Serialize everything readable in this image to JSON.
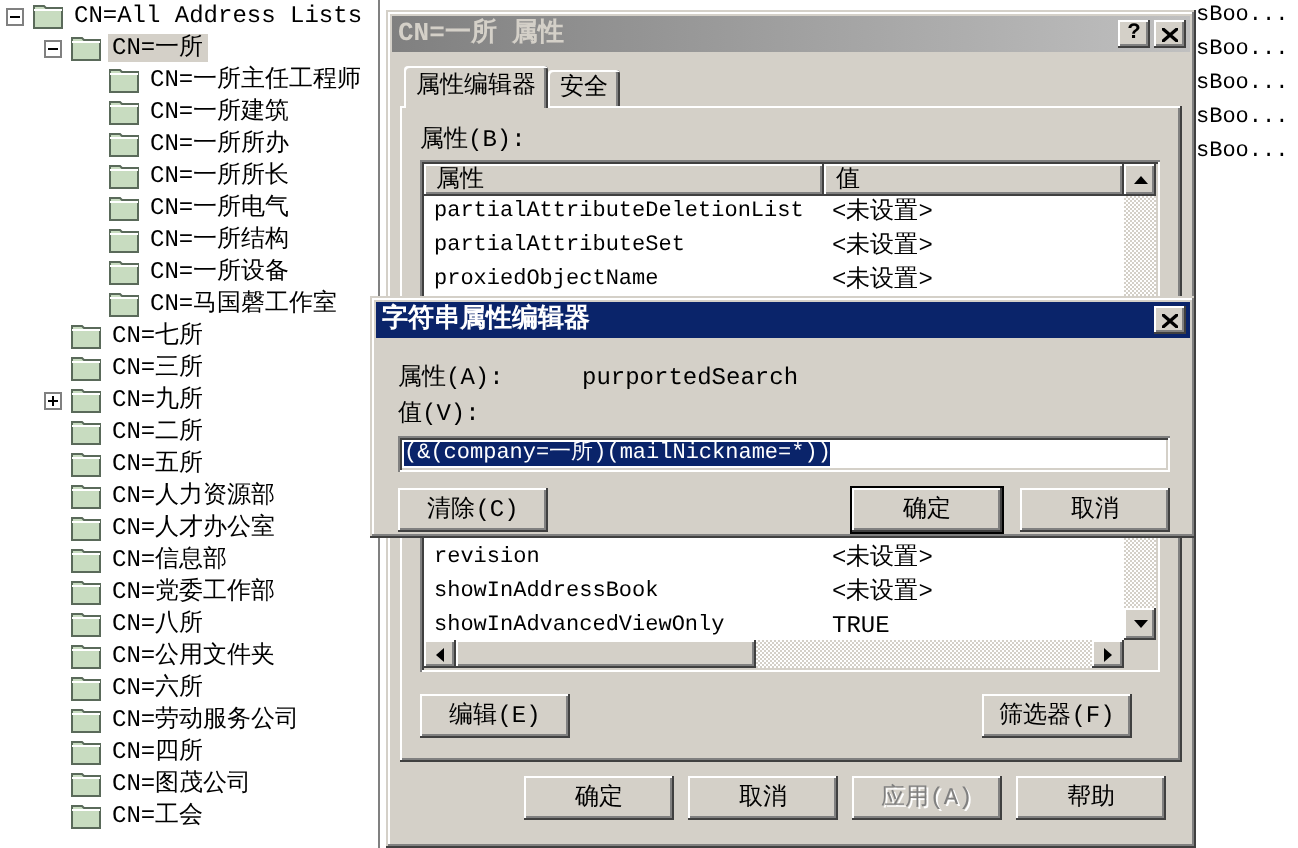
{
  "tree": [
    {
      "label": "CN=All Address Lists",
      "expanded": true,
      "selected": false,
      "children": [
        {
          "label": "CN=一所",
          "expanded": true,
          "selected": true,
          "children": [
            {
              "label": "CN=一所主任工程师",
              "selected": false
            },
            {
              "label": "CN=一所建筑",
              "selected": false
            },
            {
              "label": "CN=一所所办",
              "selected": false
            },
            {
              "label": "CN=一所所长",
              "selected": false
            },
            {
              "label": "CN=一所电气",
              "selected": false
            },
            {
              "label": "CN=一所结构",
              "selected": false
            },
            {
              "label": "CN=一所设备",
              "selected": false
            },
            {
              "label": "CN=马国磬工作室",
              "selected": false
            }
          ]
        },
        {
          "label": "CN=七所",
          "selected": false
        },
        {
          "label": "CN=三所",
          "selected": false
        },
        {
          "label": "CN=九所",
          "expanded": false,
          "selected": false
        },
        {
          "label": "CN=二所",
          "selected": false
        },
        {
          "label": "CN=五所",
          "selected": false
        },
        {
          "label": "CN=人力资源部",
          "selected": false
        },
        {
          "label": "CN=人才办公室",
          "selected": false
        },
        {
          "label": "CN=信息部",
          "selected": false
        },
        {
          "label": "CN=党委工作部",
          "selected": false
        },
        {
          "label": "CN=八所",
          "selected": false
        },
        {
          "label": "CN=公用文件夹",
          "selected": false
        },
        {
          "label": "CN=六所",
          "selected": false
        },
        {
          "label": "CN=劳动服务公司",
          "selected": false
        },
        {
          "label": "CN=四所",
          "selected": false
        },
        {
          "label": "CN=图茂公司",
          "selected": false
        },
        {
          "label": "CN=工会",
          "selected": false
        }
      ]
    }
  ],
  "background_list": [
    "sBoo...",
    "sBoo...",
    "sBoo...",
    "sBoo...",
    "sBoo..."
  ],
  "properties_dialog": {
    "title": "CN=一所 属性",
    "help_button": "?",
    "tabs": [
      {
        "label": "属性编辑器",
        "selected": true
      },
      {
        "label": "安全",
        "selected": false
      }
    ],
    "attributes_label": "属性(B):",
    "columns": [
      "属性",
      "值"
    ],
    "rows_top": [
      {
        "name": "partialAttributeDeletionList",
        "value": "<未设置>"
      },
      {
        "name": "partialAttributeSet",
        "value": "<未设置>"
      },
      {
        "name": "proxiedObjectName",
        "value": "<未设置>"
      }
    ],
    "rows_bottom": [
      {
        "name": "revision",
        "value": "<未设置>"
      },
      {
        "name": "showInAddressBook",
        "value": "<未设置>"
      },
      {
        "name": "showInAdvancedViewOnly",
        "value": "TRUE"
      }
    ],
    "edit_button": "编辑(E)",
    "filter_button": "筛选器(F)",
    "footer_buttons": [
      {
        "label": "确定",
        "disabled": false
      },
      {
        "label": "取消",
        "disabled": false
      },
      {
        "label": "应用(A)",
        "disabled": true
      },
      {
        "label": "帮助",
        "disabled": false
      }
    ]
  },
  "string_editor": {
    "title": "字符串属性编辑器",
    "attribute_label": "属性(A):",
    "attribute_value": "purportedSearch",
    "value_label": "值(V):",
    "value": "(&(company=一所)(mailNickname=*))",
    "value_selected": true,
    "clear_button": "清除(C)",
    "ok_button": "确定",
    "cancel_button": "取消"
  }
}
